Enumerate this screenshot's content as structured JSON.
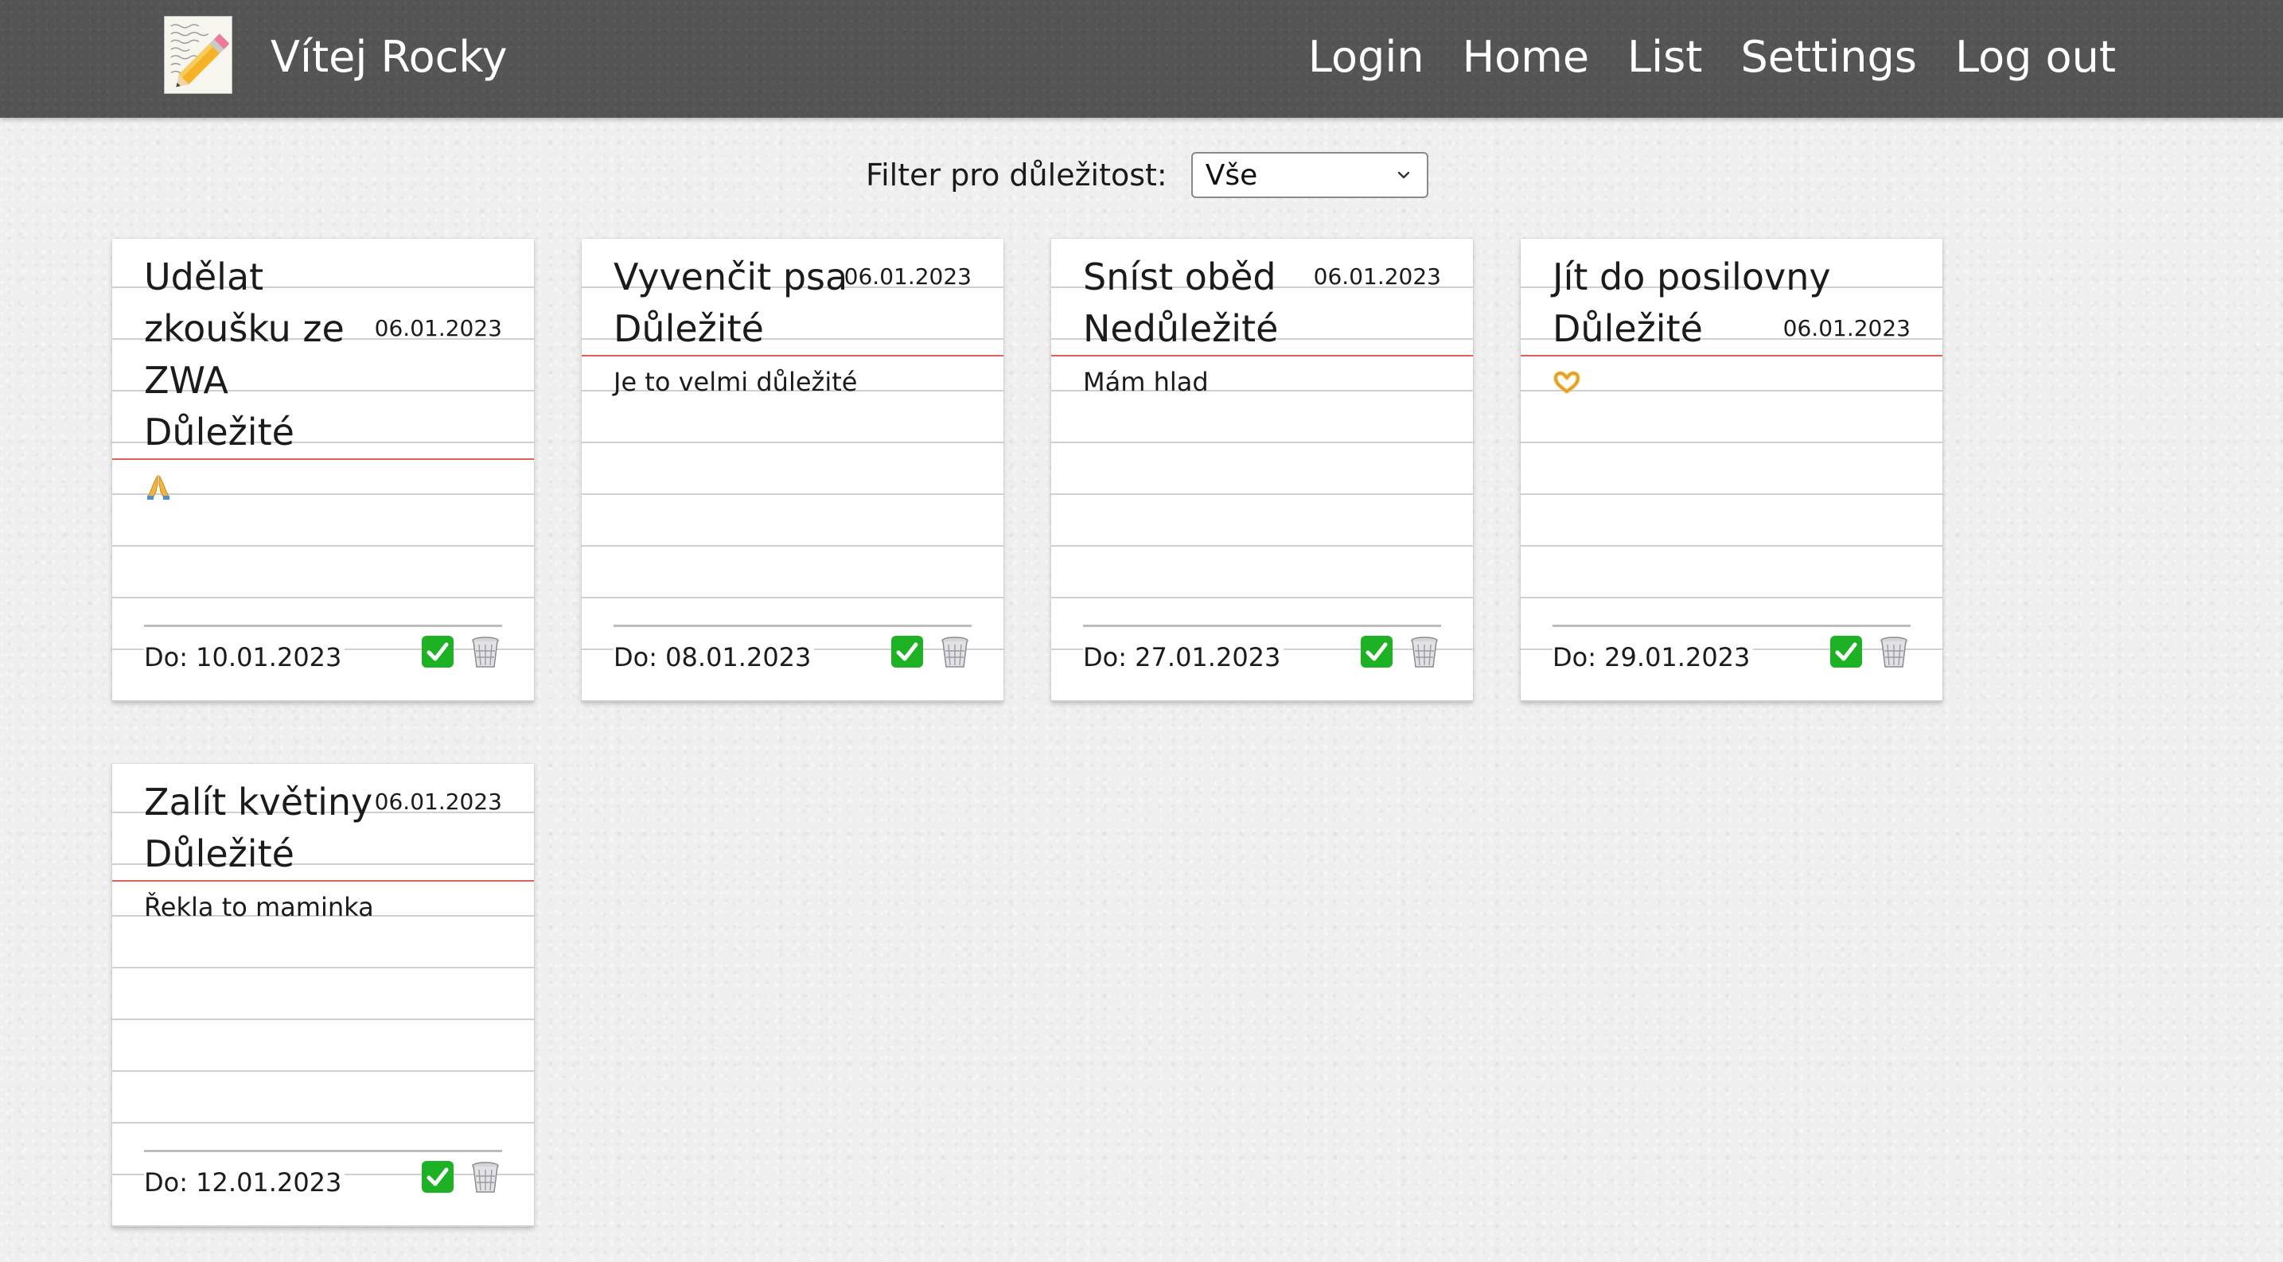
{
  "nav": {
    "brand": "Vítej Rocky",
    "links": [
      "Login",
      "Home",
      "List",
      "Settings",
      "Log out"
    ]
  },
  "filter": {
    "label": "Filter pro důležitost:",
    "selected": "Vše"
  },
  "colors": {
    "navbar": "#545454",
    "margin_line": "#e0605a",
    "check_green": "#1db224"
  },
  "tasks": [
    {
      "title": "Udělat zkoušku ze ZWA",
      "created": "06.01.2023",
      "priority": "Důležité",
      "note_icon": "folded-hands-icon",
      "due": "Do: 10.01.2023"
    },
    {
      "title": "Vyvenčit psa",
      "created": "06.01.2023",
      "priority": "Důležité",
      "note": "Je to velmi důležité",
      "due": "Do: 08.01.2023"
    },
    {
      "title": "Sníst oběd",
      "created": "06.01.2023",
      "priority": "Nedůležité",
      "note": "Mám hlad",
      "due": "Do: 27.01.2023"
    },
    {
      "title": "Jít do posilovny",
      "created": "06.01.2023",
      "priority": "Důležité",
      "note_icon": "heart-hands-icon",
      "due": "Do: 29.01.2023"
    },
    {
      "title": "Zalít květiny",
      "created": "06.01.2023",
      "priority": "Důležité",
      "note": "Řekla to maminka",
      "due": "Do: 12.01.2023"
    }
  ]
}
